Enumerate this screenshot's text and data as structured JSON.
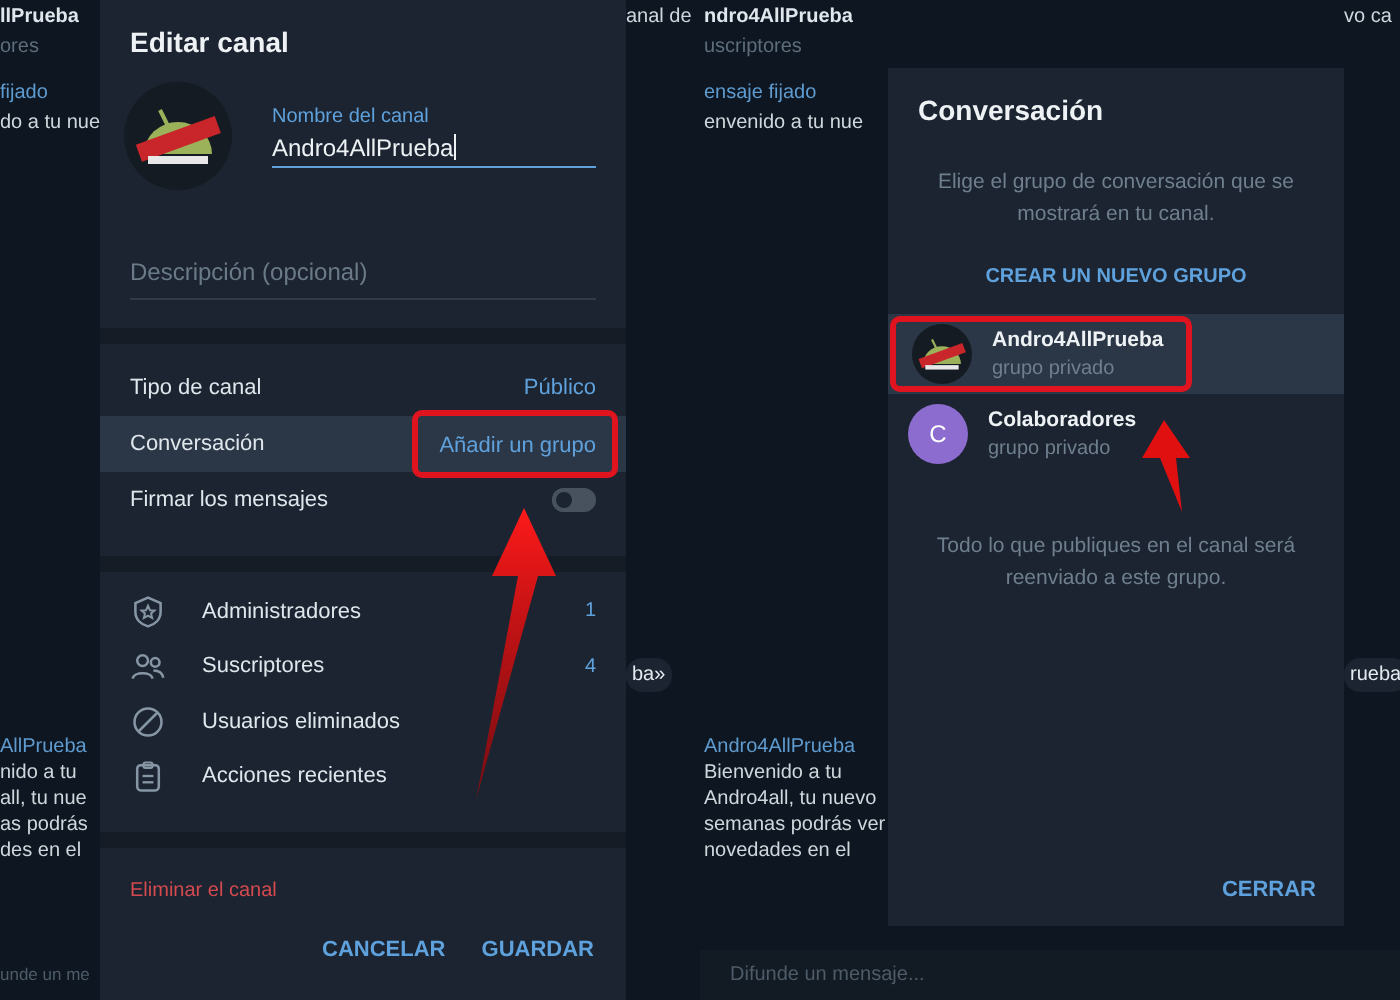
{
  "left_screen": {
    "background": {
      "left_strip": {
        "top": [
          {
            "kind": "name",
            "text": "llPrueba"
          },
          {
            "kind": "meta",
            "text": "ores"
          },
          {
            "kind": "pinned",
            "text": "fijado"
          },
          {
            "kind": "text",
            "text": "do a tu nue"
          }
        ],
        "bottom": [
          {
            "kind": "pinned",
            "text": "AllPrueba"
          },
          {
            "kind": "text",
            "text": "nido a tu"
          },
          {
            "kind": "text",
            "text": "all, tu nue"
          },
          {
            "kind": "text",
            "text": "as podrás"
          },
          {
            "kind": "text",
            "text": "des en el"
          }
        ],
        "composer": "unde un me"
      },
      "right_strip": {
        "top": [
          {
            "kind": "text",
            "text": "anal de"
          }
        ],
        "middle": [
          {
            "kind": "chip",
            "text": "ba»"
          }
        ]
      }
    },
    "edit_dialog": {
      "title": "Editar canal",
      "name_field": {
        "label": "Nombre del canal",
        "value": "Andro4AllPrueba",
        "focused": true
      },
      "description_field": {
        "placeholder": "Descripción (opcional)"
      },
      "settings": [
        {
          "kind": "link",
          "label": "Tipo de canal",
          "value": "Público",
          "highlighted": false,
          "annotated": false
        },
        {
          "kind": "link",
          "label": "Conversación",
          "value": "Añadir un grupo",
          "highlighted": true,
          "annotated": true
        },
        {
          "kind": "toggle",
          "label": "Firmar los mensajes",
          "on": false,
          "highlighted": false,
          "annotated": false
        }
      ],
      "manage": [
        {
          "label": "Administradores",
          "count": "1"
        },
        {
          "label": "Suscriptores",
          "count": "4"
        },
        {
          "label": "Usuarios eliminados"
        },
        {
          "label": "Acciones recientes"
        }
      ],
      "delete_label": "Eliminar el canal",
      "buttons": [
        "CANCELAR",
        "GUARDAR"
      ]
    }
  },
  "right_screen": {
    "background": {
      "left_strip": {
        "top": [
          {
            "kind": "name",
            "text": "ndro4AllPrueba"
          },
          {
            "kind": "meta",
            "text": "uscriptores"
          },
          {
            "kind": "pinned",
            "text": "ensaje fijado"
          },
          {
            "kind": "text",
            "text": "envenido a tu nue"
          }
        ],
        "bottom": [
          {
            "kind": "pinned",
            "text": "Andro4AllPrueba"
          },
          {
            "kind": "text",
            "text": "Bienvenido a tu"
          },
          {
            "kind": "text",
            "text": "Andro4all, tu nuevo"
          },
          {
            "kind": "text",
            "text": "semanas podrás ver"
          },
          {
            "kind": "text",
            "text": "novedades en el"
          }
        ]
      },
      "right_strip": {
        "top": [
          {
            "kind": "text",
            "text": "vo ca"
          }
        ],
        "middle": [
          {
            "kind": "chip",
            "text": "rueba"
          }
        ]
      },
      "composer": "Difunde un mensaje..."
    },
    "group_dialog": {
      "title": "Conversación",
      "intro": "Elige el grupo de conversación que se mostrará en tu canal.",
      "create_button": "CREAR UN NUEVO GRUPO",
      "groups": [
        {
          "name": "Andro4AllPrueba",
          "subtitle": "grupo privado",
          "selected": true,
          "annotated": true
        },
        {
          "name": "Colaboradores",
          "subtitle": "grupo privado",
          "initial": "C",
          "selected": false,
          "annotated": false
        }
      ],
      "note": "Todo lo que publiques en el canal será reenviado a este grupo.",
      "close_button": "CERRAR"
    }
  }
}
